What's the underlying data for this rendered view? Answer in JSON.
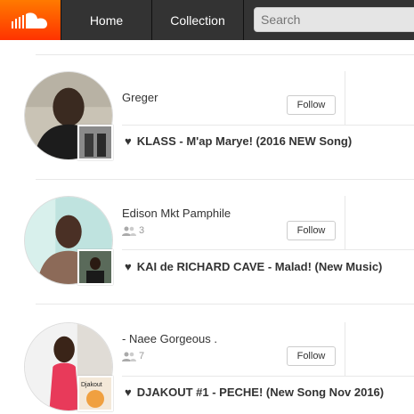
{
  "header": {
    "logo_icon": "soundcloud-cloud-icon",
    "tabs": [
      {
        "label": "Home"
      },
      {
        "label": "Collection"
      }
    ],
    "search_placeholder": "Search"
  },
  "feed": [
    {
      "username": "Greger",
      "followers": "",
      "follow_label": "Follow",
      "track": "KLASS - M'ap Marye! (2016 NEW Song)"
    },
    {
      "username": "Edison Mkt Pamphile",
      "followers": "3",
      "follow_label": "Follow",
      "track": "KAI de RICHARD CAVE - Malad! (New Music)"
    },
    {
      "username": "- Naee Gorgeous .",
      "followers": "7",
      "follow_label": "Follow",
      "track": "DJAKOUT #1 - PECHE! (New Song Nov 2016)",
      "artwork_text": "Djakout"
    }
  ],
  "colors": {
    "brand": "#ff5500",
    "header_bg": "#333333"
  }
}
